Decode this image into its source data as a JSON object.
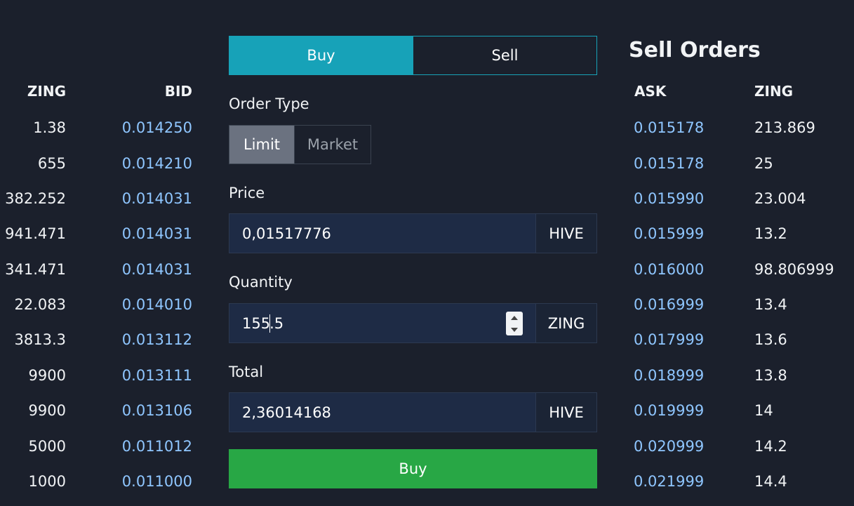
{
  "buy_book": {
    "col_amount": "ZING",
    "col_price": "BID",
    "rows": [
      {
        "amount": "1.38",
        "price": "0.014250"
      },
      {
        "amount": "655",
        "price": "0.014210"
      },
      {
        "amount": "382.252",
        "price": "0.014031"
      },
      {
        "amount": "941.471",
        "price": "0.014031"
      },
      {
        "amount": "341.471",
        "price": "0.014031"
      },
      {
        "amount": "22.083",
        "price": "0.014010"
      },
      {
        "amount": "3813.3",
        "price": "0.013112"
      },
      {
        "amount": "9900",
        "price": "0.013111"
      },
      {
        "amount": "9900",
        "price": "0.013106"
      },
      {
        "amount": "5000",
        "price": "0.011012"
      },
      {
        "amount": "1000",
        "price": "0.011000"
      }
    ]
  },
  "form": {
    "buy_tab": "Buy",
    "sell_tab": "Sell",
    "order_type_label": "Order Type",
    "limit_label": "Limit",
    "market_label": "Market",
    "price_label": "Price",
    "price_value": "0,01517776",
    "price_unit": "HIVE",
    "quantity_label": "Quantity",
    "quantity_value_before_cursor": "155",
    "quantity_value_after_cursor": ".5",
    "quantity_unit": "ZING",
    "total_label": "Total",
    "total_value": "2,36014168",
    "total_unit": "HIVE",
    "submit_label": "Buy"
  },
  "sell_book": {
    "title": "Sell Orders",
    "col_price": "ASK",
    "col_amount": "ZING",
    "rows": [
      {
        "price": "0.015178",
        "amount": "213.869"
      },
      {
        "price": "0.015178",
        "amount": "25"
      },
      {
        "price": "0.015990",
        "amount": "23.004"
      },
      {
        "price": "0.015999",
        "amount": "13.2"
      },
      {
        "price": "0.016000",
        "amount": "98.806999"
      },
      {
        "price": "0.016999",
        "amount": "13.4"
      },
      {
        "price": "0.017999",
        "amount": "13.6"
      },
      {
        "price": "0.018999",
        "amount": "13.8"
      },
      {
        "price": "0.019999",
        "amount": "14"
      },
      {
        "price": "0.020999",
        "amount": "14.2"
      },
      {
        "price": "0.021999",
        "amount": "14.4"
      }
    ]
  }
}
